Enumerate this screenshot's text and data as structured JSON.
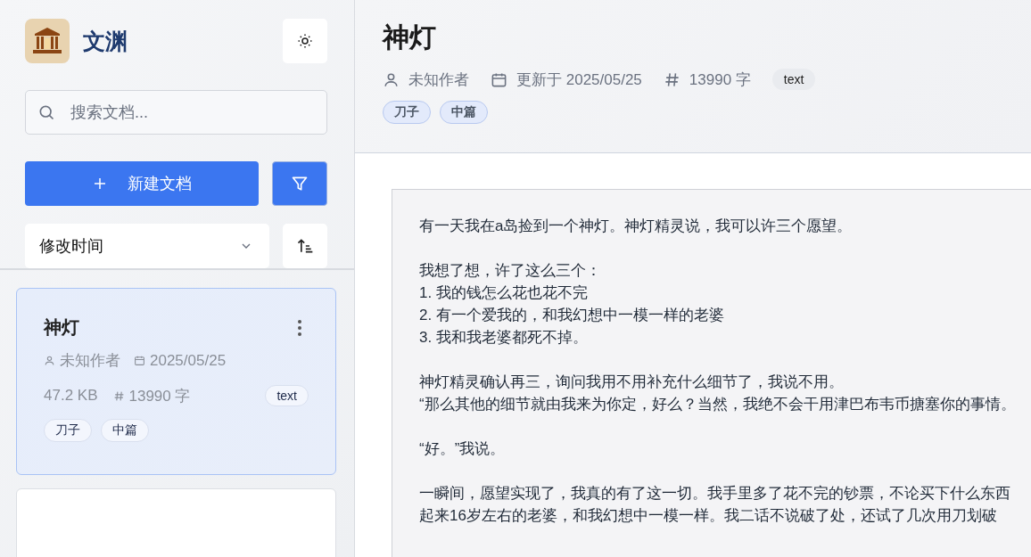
{
  "app": {
    "name": "文渊"
  },
  "search": {
    "placeholder": "搜索文档..."
  },
  "new_button": {
    "label": "新建文档"
  },
  "sort": {
    "value": "修改时间"
  },
  "documents": [
    {
      "title": "神灯",
      "author": "未知作者",
      "date": "2025/05/25",
      "size": "47.2 KB",
      "words": "13990 字",
      "format": "text",
      "tags": [
        "刀子",
        "中篇"
      ],
      "selected": true
    },
    {
      "selected": false
    }
  ],
  "header": {
    "title": "神灯",
    "author": "未知作者",
    "updated": "更新于 2025/05/25",
    "words": "13990 字",
    "format": "text",
    "tags": [
      "刀子",
      "中篇"
    ]
  },
  "content": {
    "paragraphs": [
      [
        "有一天我在a岛捡到一个神灯。神灯精灵说，我可以许三个愿望。"
      ],
      [
        "我想了想，许了这么三个：",
        "1. 我的钱怎么花也花不完",
        "2. 有一个爱我的，和我幻想中一模一样的老婆",
        "3. 我和我老婆都死不掉。"
      ],
      [
        "神灯精灵确认再三，询问我用不用补充什么细节了，我说不用。",
        "“那么其他的细节就由我来为你定，好么？当然，我绝不会干用津巴布韦币搪塞你的事情。"
      ],
      [
        "“好。”我说。"
      ],
      [
        "一瞬间，愿望实现了，我真的有了这一切。我手里多了花不完的钞票，不论买下什么东西",
        "起来16岁左右的老婆，和我幻想中一模一样。我二话不说破了处，还试了几次用刀划破"
      ]
    ]
  }
}
